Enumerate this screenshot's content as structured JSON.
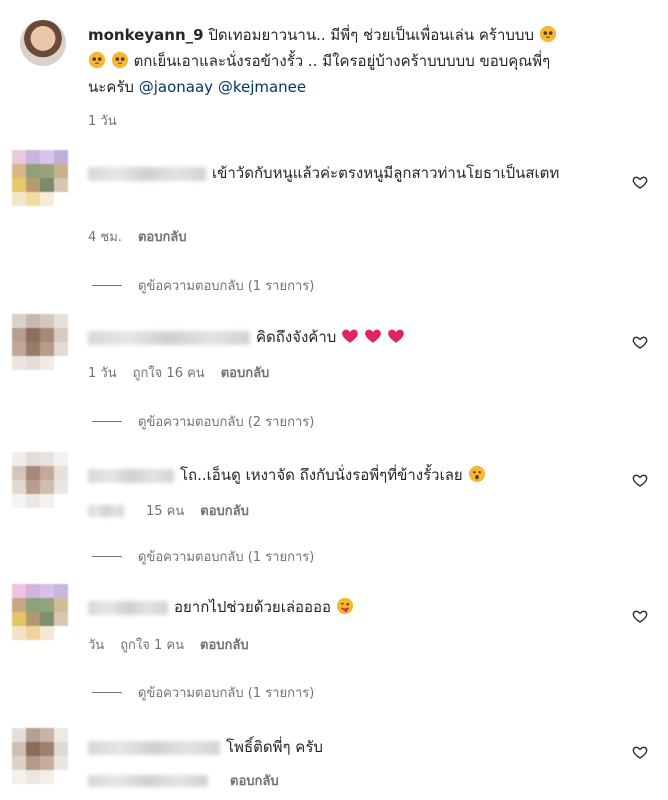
{
  "post": {
    "username": "monkeyann_9",
    "caption_line1": "ปิดเทอมยาวนาน.. มีพี่ๆ ช่วยเป็นเพื่อนเล่น คร้าบบบ",
    "caption_line2": "ตกเย็นเอาและนั่งรอข้างรั้ว .. มีใครอยู่บ้างคร้าบบบบบ ขอบคุณพี่ๆ",
    "caption_line3_prefix": "นะครับ",
    "mention1": "@jaonaay",
    "mention2": "@kejmanee",
    "time": "1 วัน"
  },
  "comments": [
    {
      "text": "เข้าวัดกับหนูแล้วค่ะตรงหนูมีลูกสาวท่านโยธาเป็นสเตท",
      "time": "4 ชม.",
      "likes": "",
      "reply_label": "ตอบกลับ",
      "view_replies": "ดูข้อความตอบกลับ (1 รายการ)"
    },
    {
      "text": "คิดถึงจังค้าบ",
      "time": "1 วัน",
      "likes": "ถูกใจ 16 คน",
      "reply_label": "ตอบกลับ",
      "view_replies": "ดูข้อความตอบกลับ (2 รายการ)"
    },
    {
      "text": "โถ..เอ็นดู เหงาจัด ถึงกับนั่งรอพี่ๆที่ข้างรั้วเลย",
      "time": "",
      "likes": "15 คน",
      "reply_label": "ตอบกลับ",
      "view_replies": "ดูข้อความตอบกลับ (1 รายการ)"
    },
    {
      "text": "อยากไปช่วยด้วยเล่ออออ",
      "time": "วัน",
      "likes": "ถูกใจ 1 คน",
      "reply_label": "ตอบกลับ",
      "view_replies": "ดูข้อความตอบกลับ (1 รายการ)"
    },
    {
      "text": "โพธิ์ติดพี่ๆ ครับ",
      "time": "",
      "likes": "",
      "reply_label": "ตอบกลับ",
      "view_replies": ""
    }
  ],
  "icons": {
    "heart": "heart-outline-icon",
    "red_heart": "red-heart-emoji"
  },
  "colors": {
    "mention": "#00376b",
    "muted": "#737373",
    "heart_red": "#e0245e",
    "emoji_yellow": "#f7b731"
  }
}
